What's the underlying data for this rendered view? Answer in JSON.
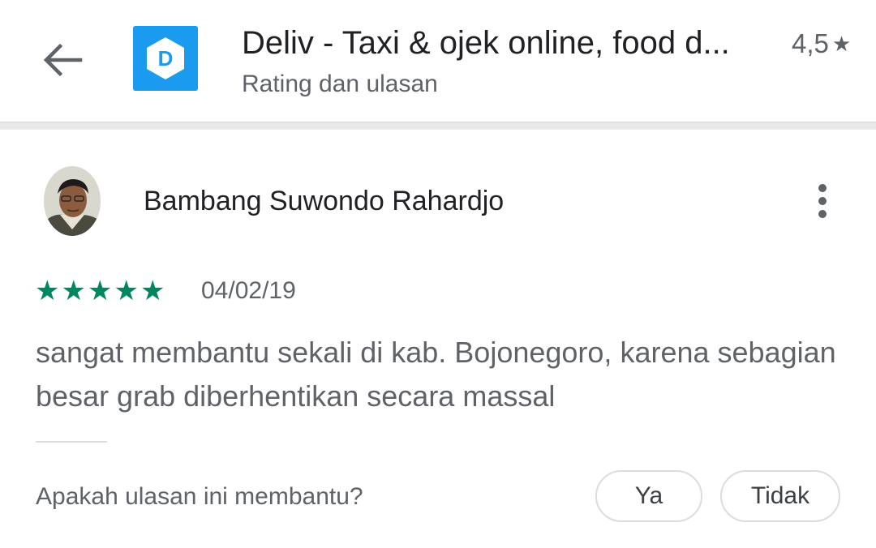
{
  "header": {
    "back_icon": "arrow-left-icon",
    "app_icon": "deliv-logo-icon",
    "app_icon_letter": "D",
    "app_title": "Deliv - Taxi & ojek online, food d...",
    "subtitle": "Rating dan ulasan",
    "rating": "4,5",
    "rating_star": "★"
  },
  "review": {
    "reviewer_name": "Bambang Suwondo Rahardjo",
    "more_icon": "more-vertical-icon",
    "star_count": 5,
    "star_glyph": "★",
    "date": "04/02/19",
    "text": "sangat membantu sekali di kab. Bojonegoro, karena sebagian besar grab diberhentikan secara massal"
  },
  "helpful": {
    "question": "Apakah ulasan ini membantu?",
    "yes_label": "Ya",
    "no_label": "Tidak"
  },
  "colors": {
    "star_green": "#01875f",
    "app_icon_blue": "#1a9bf0",
    "text_primary": "#202124",
    "text_secondary": "#5f6368"
  }
}
